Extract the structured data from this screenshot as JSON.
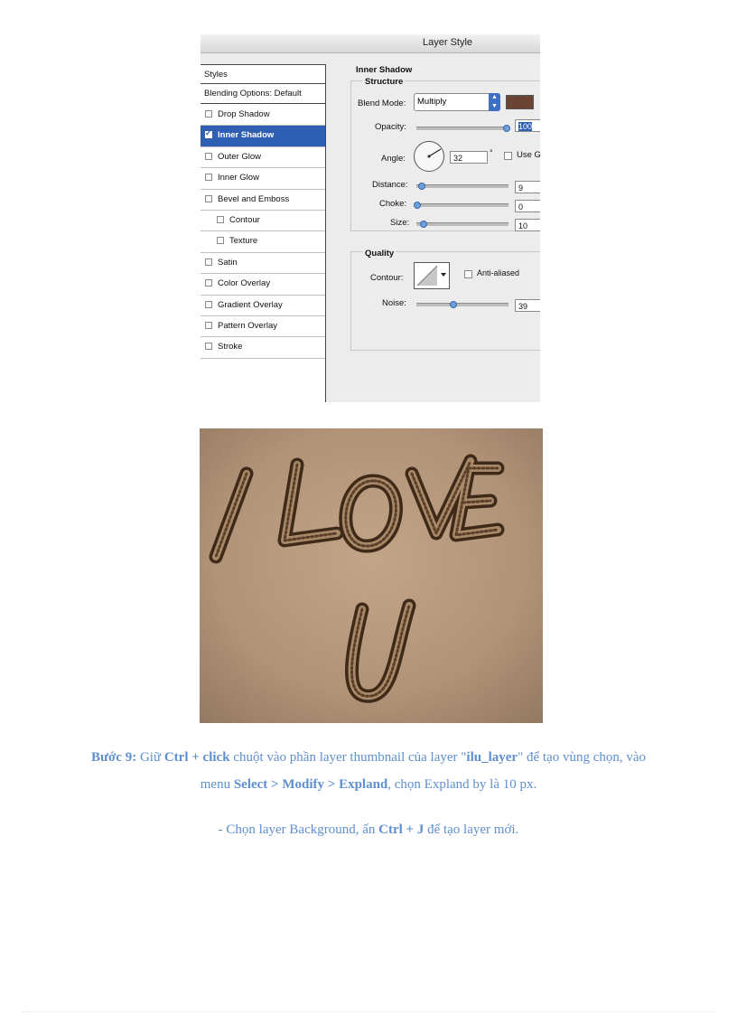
{
  "dialog": {
    "title": "Layer Style",
    "styles_header": "Styles",
    "blending_options": "Blending Options: Default",
    "effects": [
      {
        "label": "Drop Shadow",
        "checked": false,
        "selected": false
      },
      {
        "label": "Inner Shadow",
        "checked": true,
        "selected": true
      },
      {
        "label": "Outer Glow",
        "checked": false,
        "selected": false
      },
      {
        "label": "Inner Glow",
        "checked": false,
        "selected": false
      },
      {
        "label": "Bevel and Emboss",
        "checked": false,
        "selected": false
      },
      {
        "label": "Contour",
        "checked": false,
        "selected": false
      },
      {
        "label": "Texture",
        "checked": false,
        "selected": false
      },
      {
        "label": "Satin",
        "checked": false,
        "selected": false
      },
      {
        "label": "Color Overlay",
        "checked": false,
        "selected": false
      },
      {
        "label": "Gradient Overlay",
        "checked": false,
        "selected": false
      },
      {
        "label": "Pattern Overlay",
        "checked": false,
        "selected": false
      },
      {
        "label": "Stroke",
        "checked": false,
        "selected": false
      }
    ],
    "panel": {
      "section_title": "Inner Shadow",
      "structure_title": "Structure",
      "blend_mode_label": "Blend Mode:",
      "blend_mode_value": "Multiply",
      "shadow_color": "#6b4434",
      "opacity_label": "Opacity:",
      "opacity_value": "100",
      "angle_label": "Angle:",
      "angle_value": "32",
      "angle_unit": "°",
      "use_global_label": "Use G",
      "distance_label": "Distance:",
      "distance_value": "9",
      "choke_label": "Choke:",
      "choke_value": "0",
      "size_label": "Size:",
      "size_value": "10",
      "quality_title": "Quality",
      "contour_label": "Contour:",
      "anti_aliased_label": "Anti-aliased",
      "noise_label": "Noise:",
      "noise_value": "39"
    }
  },
  "photo": {
    "line1": "I LOVE",
    "line2": "U"
  },
  "instructions": {
    "step_label": "Bước 9:",
    "p1_a": " Giữ ",
    "p1_b": "Ctrl + click",
    "p1_c": " chuột vào phần  layer thumbnail  của layer \"",
    "p1_d": "ilu_layer",
    "p1_e": "\" để tạo vùng  chọn, vào",
    "p2_a": "menu ",
    "p2_b": "Select > Modify > Expland",
    "p2_c": ", chọn Expland  by là 10 px.",
    "p3_a": "- Chọn layer Background,  ấn ",
    "p3_b": "Ctrl + J",
    "p3_c": " để tạo layer mới."
  }
}
